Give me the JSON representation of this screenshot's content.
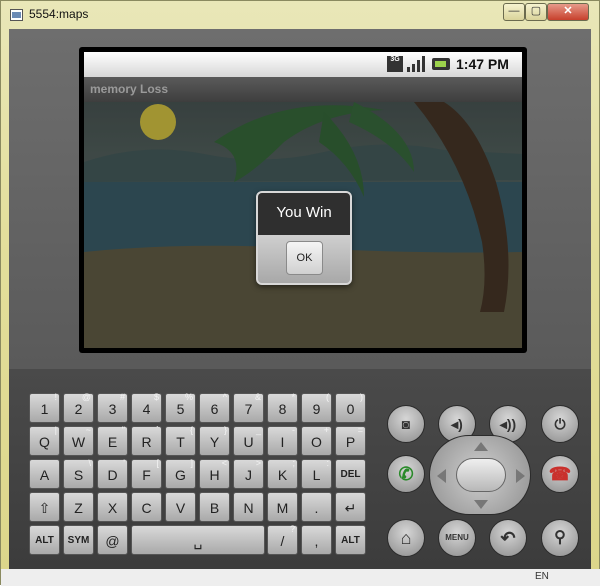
{
  "window": {
    "title": "5554:maps",
    "min": "—",
    "max": "▢",
    "close": "✕"
  },
  "status": {
    "net": "3G",
    "time": "1:47 PM"
  },
  "app": {
    "title": "memory Loss"
  },
  "dialog": {
    "title": "You Win",
    "ok": "OK"
  },
  "keyboard": {
    "row1": [
      {
        "k": "1",
        "a": "!"
      },
      {
        "k": "2",
        "a": "@"
      },
      {
        "k": "3",
        "a": "#"
      },
      {
        "k": "4",
        "a": "$"
      },
      {
        "k": "5",
        "a": "%"
      },
      {
        "k": "6",
        "a": "^"
      },
      {
        "k": "7",
        "a": "&"
      },
      {
        "k": "8",
        "a": "*"
      },
      {
        "k": "9",
        "a": "("
      },
      {
        "k": "0",
        "a": ")"
      }
    ],
    "row2": [
      {
        "k": "Q",
        "a": "|"
      },
      {
        "k": "W",
        "a": "~"
      },
      {
        "k": "E",
        "a": "\""
      },
      {
        "k": "R",
        "a": "`"
      },
      {
        "k": "T",
        "a": "{"
      },
      {
        "k": "Y",
        "a": "}"
      },
      {
        "k": "U",
        "a": "_"
      },
      {
        "k": "I",
        "a": "-"
      },
      {
        "k": "O",
        "a": "+"
      },
      {
        "k": "P",
        "a": "="
      }
    ],
    "row3": [
      {
        "k": "A",
        "a": ""
      },
      {
        "k": "S",
        "a": "\\"
      },
      {
        "k": "D",
        "a": "'"
      },
      {
        "k": "F",
        "a": "["
      },
      {
        "k": "G",
        "a": "]"
      },
      {
        "k": "H",
        "a": "<"
      },
      {
        "k": "J",
        "a": ">"
      },
      {
        "k": "K",
        "a": ";"
      },
      {
        "k": "L",
        "a": ":"
      },
      {
        "k": "DEL",
        "a": ""
      }
    ],
    "row4": [
      {
        "k": "⇧",
        "a": ""
      },
      {
        "k": "Z",
        "a": ""
      },
      {
        "k": "X",
        "a": ""
      },
      {
        "k": "C",
        "a": ""
      },
      {
        "k": "V",
        "a": ""
      },
      {
        "k": "B",
        "a": ""
      },
      {
        "k": "N",
        "a": ""
      },
      {
        "k": "M",
        "a": ""
      },
      {
        "k": ".",
        "a": ""
      },
      {
        "k": "↵",
        "a": ""
      }
    ],
    "row5": [
      {
        "k": "ALT",
        "a": ""
      },
      {
        "k": "SYM",
        "a": ""
      },
      {
        "k": "@",
        "a": ""
      },
      {
        "k": "␣",
        "a": ""
      },
      {
        "k": "/",
        "a": "?"
      },
      {
        "k": ",",
        "a": ""
      },
      {
        "k": "ALT",
        "a": ""
      }
    ]
  },
  "hw": {
    "menu": "MENU"
  },
  "taskbar": {
    "lang": "EN"
  }
}
